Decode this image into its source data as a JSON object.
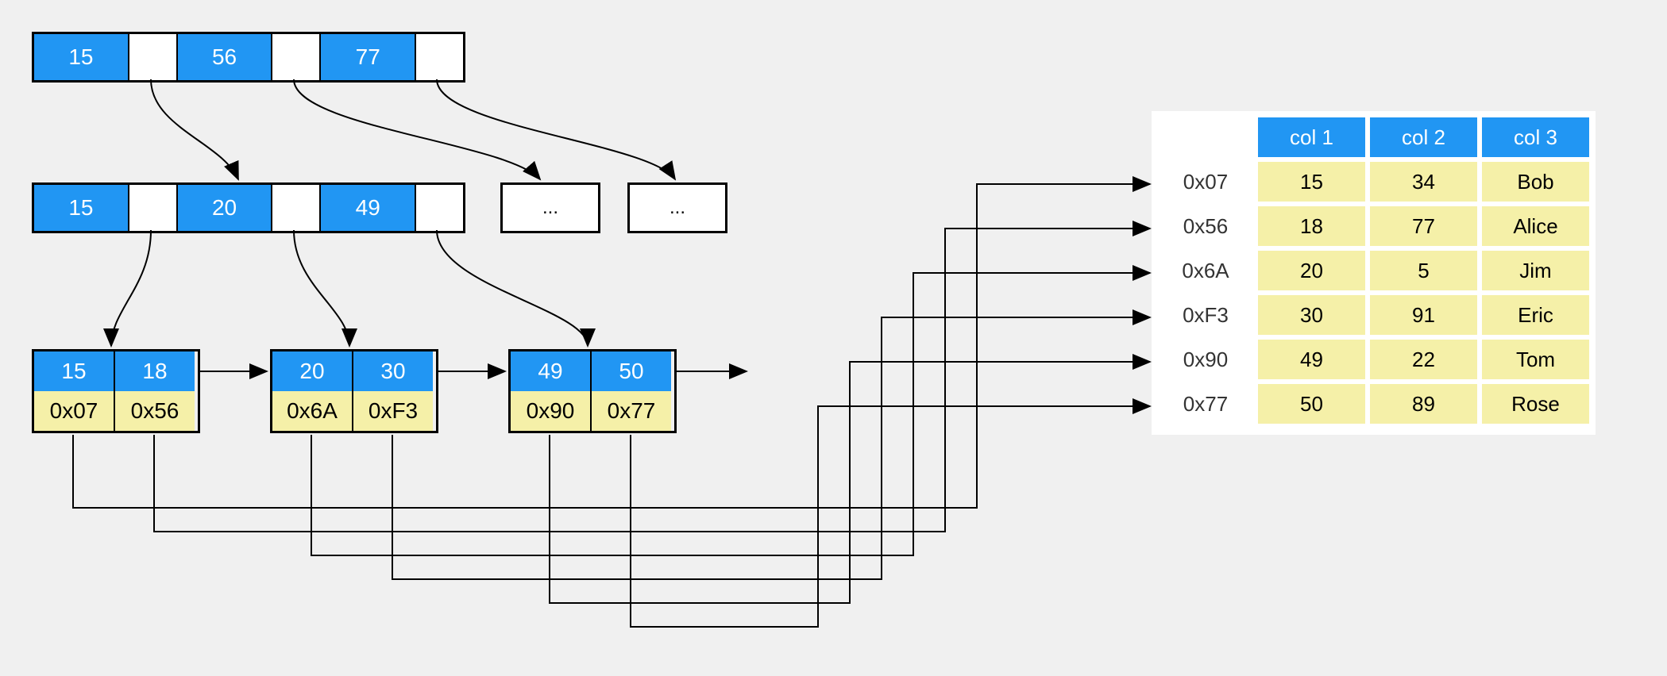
{
  "root_node": {
    "keys": [
      "15",
      "56",
      "77"
    ]
  },
  "internal_node": {
    "keys": [
      "15",
      "20",
      "49"
    ]
  },
  "sibling_placeholder": "...",
  "leaves": [
    {
      "keys": [
        "15",
        "18"
      ],
      "pointers": [
        "0x07",
        "0x56"
      ]
    },
    {
      "keys": [
        "20",
        "30"
      ],
      "pointers": [
        "0x6A",
        "0xF3"
      ]
    },
    {
      "keys": [
        "49",
        "50"
      ],
      "pointers": [
        "0x90",
        "0x77"
      ]
    }
  ],
  "table": {
    "headers": [
      "col 1",
      "col 2",
      "col 3"
    ],
    "rows": [
      {
        "addr": "0x07",
        "cells": [
          "15",
          "34",
          "Bob"
        ]
      },
      {
        "addr": "0x56",
        "cells": [
          "18",
          "77",
          "Alice"
        ]
      },
      {
        "addr": "0x6A",
        "cells": [
          "20",
          "5",
          "Jim"
        ]
      },
      {
        "addr": "0xF3",
        "cells": [
          "30",
          "91",
          "Eric"
        ]
      },
      {
        "addr": "0x90",
        "cells": [
          "49",
          "22",
          "Tom"
        ]
      },
      {
        "addr": "0x77",
        "cells": [
          "50",
          "89",
          "Rose"
        ]
      }
    ]
  }
}
